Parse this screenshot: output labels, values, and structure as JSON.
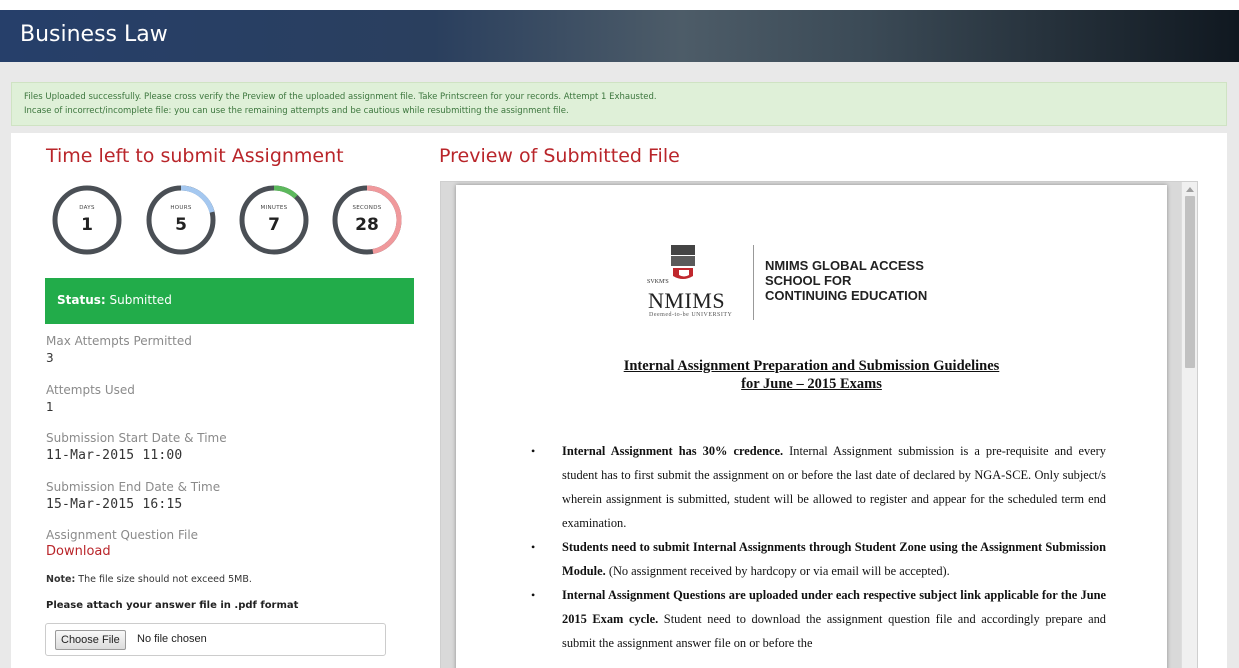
{
  "header": {
    "title": "Business Law"
  },
  "alert": {
    "line1": "Files Uploaded successfully. Please cross verify the Preview of the uploaded assignment file. Take Printscreen for your records. Attempt 1 Exhausted.",
    "line2": "Incase of incorrect/incomplete file: you can use the remaining attempts and be cautious while resubmitting the assignment file."
  },
  "left": {
    "heading": "Time left to submit Assignment",
    "timers": [
      {
        "label": "DAYS",
        "value": "1",
        "progress": 0.0,
        "color": "#a5c8f0"
      },
      {
        "label": "HOURS",
        "value": "5",
        "progress": 0.21,
        "color": "#a5c8f0"
      },
      {
        "label": "MINUTES",
        "value": "7",
        "progress": 0.12,
        "color": "#5cb85c"
      },
      {
        "label": "SECONDS",
        "value": "28",
        "progress": 0.47,
        "color": "#f0999c"
      }
    ],
    "status_label": "Status:",
    "status_value": "Submitted",
    "fields": {
      "max_attempts_label": "Max Attempts Permitted",
      "max_attempts_value": "3",
      "attempts_used_label": "Attempts Used",
      "attempts_used_value": "1",
      "start_label": "Submission Start Date & Time",
      "start_value": "11-Mar-2015 11:00",
      "end_label": "Submission End Date & Time",
      "end_value": "15-Mar-2015 16:15",
      "question_file_label": "Assignment Question File",
      "download_label": "Download"
    },
    "note_label": "Note:",
    "note_text": "The file size should not exceed 5MB.",
    "attach_text": "Please attach your answer file in .pdf format",
    "choose_file_label": "Choose File",
    "no_file_text": "No file chosen"
  },
  "preview": {
    "heading": "Preview of Submitted File",
    "logo": {
      "svkms": "SVKM'S",
      "nmims": "NMIMS",
      "deemed": "Deemed-to-be UNIVERSITY",
      "school_line1": "NMIMS GLOBAL ACCESS",
      "school_line2": "SCHOOL FOR",
      "school_line3": "CONTINUING EDUCATION"
    },
    "doc_title_line1": "Internal Assignment Preparation and Submission Guidelines",
    "doc_title_line2": "for June – 2015 Exams",
    "bullets": [
      {
        "bold": "Internal Assignment has 30% credence.",
        "text": " Internal Assignment submission is a pre-requisite and every student has to first submit the assignment on or before the last date of declared by NGA-SCE. Only subject/s wherein assignment is submitted, student will be allowed to register and appear for the scheduled term end examination."
      },
      {
        "bold": "Students need to submit Internal Assignments through Student Zone using the Assignment Submission Module.",
        "text": " (No assignment received by hardcopy or via email will be accepted)."
      },
      {
        "bold": "Internal Assignment Questions are uploaded under each respective subject link applicable for the June 2015 Exam cycle.",
        "text": " Student need to download the assignment question file and accordingly prepare and submit the assignment answer file on or before the"
      }
    ]
  }
}
